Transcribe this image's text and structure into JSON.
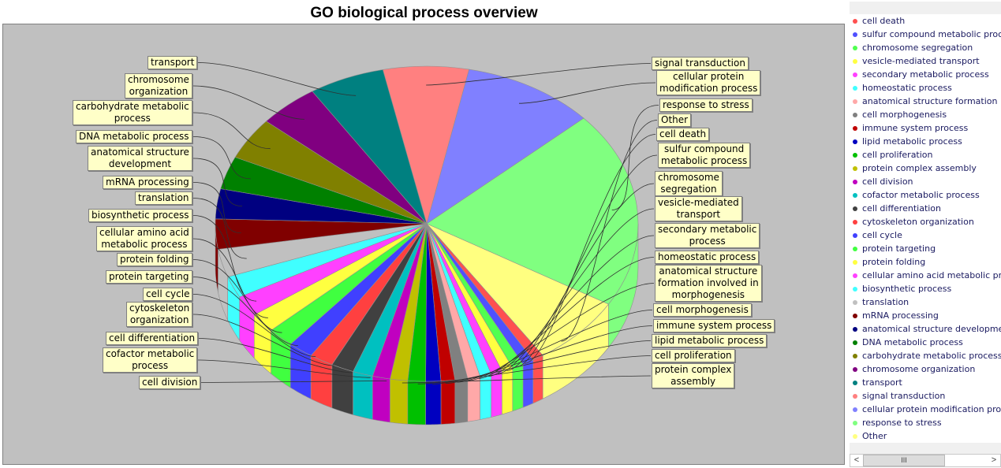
{
  "chart_data": {
    "type": "pie",
    "title": "GO biological process overview",
    "legend_position": "right",
    "slices": [
      {
        "label": "signal transduction",
        "value": 6.8,
        "color": "#ff8080"
      },
      {
        "label": "cellular protein modification process",
        "value": 10.5,
        "color": "#8080ff"
      },
      {
        "label": "response to stress",
        "value": 21.0,
        "color": "#80ff80"
      },
      {
        "label": "Other",
        "value": 7.5,
        "color": "#ffff80"
      },
      {
        "label": "cell death",
        "value": 0.9,
        "color": "#ff5050"
      },
      {
        "label": "sulfur compound metabolic process",
        "value": 0.9,
        "color": "#5050ff"
      },
      {
        "label": "chromosome segregation",
        "value": 0.9,
        "color": "#50ff50"
      },
      {
        "label": "vesicle-mediated transport",
        "value": 0.9,
        "color": "#ffff40"
      },
      {
        "label": "secondary metabolic process",
        "value": 0.9,
        "color": "#ff40ff"
      },
      {
        "label": "homeostatic process",
        "value": 0.9,
        "color": "#40ffff"
      },
      {
        "label": "anatomical structure formation involved in morphogenesis",
        "value": 1.0,
        "color": "#ffa8a8"
      },
      {
        "label": "cell morphogenesis",
        "value": 1.0,
        "color": "#808080"
      },
      {
        "label": "immune system process",
        "value": 1.1,
        "color": "#c00000"
      },
      {
        "label": "lipid metabolic process",
        "value": 1.2,
        "color": "#0000c0"
      },
      {
        "label": "cell proliferation",
        "value": 1.4,
        "color": "#00c000"
      },
      {
        "label": "protein complex assembly",
        "value": 1.4,
        "color": "#c0c000"
      },
      {
        "label": "cell division",
        "value": 1.4,
        "color": "#c000c0"
      },
      {
        "label": "cofactor metabolic process",
        "value": 1.6,
        "color": "#00c0c0"
      },
      {
        "label": "cell differentiation",
        "value": 1.8,
        "color": "#404040"
      },
      {
        "label": "cytoskeleton organization",
        "value": 1.9,
        "color": "#ff4040"
      },
      {
        "label": "cell cycle",
        "value": 2.0,
        "color": "#4040ff"
      },
      {
        "label": "protein targeting",
        "value": 2.1,
        "color": "#40ff40"
      },
      {
        "label": "protein folding",
        "value": 2.1,
        "color": "#ffff40"
      },
      {
        "label": "cellular amino acid metabolic process",
        "value": 2.2,
        "color": "#ff40ff"
      },
      {
        "label": "biosynthetic process",
        "value": 2.3,
        "color": "#40ffff"
      },
      {
        "label": "translation",
        "value": 3.0,
        "color": "#c0c0c0"
      },
      {
        "label": "mRNA processing",
        "value": 3.2,
        "color": "#800000"
      },
      {
        "label": "anatomical structure development",
        "value": 3.2,
        "color": "#000080"
      },
      {
        "label": "DNA metabolic process",
        "value": 3.5,
        "color": "#008000"
      },
      {
        "label": "carbohydrate metabolic process",
        "value": 4.5,
        "color": "#808000"
      },
      {
        "label": "chromosome organization",
        "value": 4.8,
        "color": "#800080"
      },
      {
        "label": "transport",
        "value": 6.0,
        "color": "#008080"
      }
    ],
    "callout_labels_left": [
      "transport",
      "chromosome\norganization",
      "carbohydrate metabolic\nprocess",
      "DNA metabolic process",
      "anatomical structure\ndevelopment",
      "mRNA processing",
      "translation",
      "biosynthetic process",
      "cellular amino acid\nmetabolic process",
      "protein folding",
      "protein targeting",
      "cell cycle",
      "cytoskeleton\norganization",
      "cell differentiation",
      "cofactor metabolic\nprocess",
      "cell division"
    ],
    "callout_labels_right": [
      "signal transduction",
      "cellular protein\nmodification process",
      "response to stress",
      "Other",
      "cell death",
      "sulfur compound\nmetabolic process",
      "chromosome\nsegregation",
      "vesicle-mediated\ntransport",
      "secondary metabolic\nprocess",
      "homeostatic process",
      "anatomical structure\nformation involved in\nmorphogenesis",
      "cell morphogenesis",
      "immune system process",
      "lipid metabolic process",
      "cell proliferation",
      "protein complex\nassembly"
    ]
  },
  "legend": {
    "items": [
      {
        "label": "cell death",
        "color": "#ff5050"
      },
      {
        "label": "sulfur compound metabolic process",
        "color": "#5050ff"
      },
      {
        "label": "chromosome segregation",
        "color": "#50ff50"
      },
      {
        "label": "vesicle-mediated transport",
        "color": "#ffff40"
      },
      {
        "label": "secondary metabolic process",
        "color": "#ff40ff"
      },
      {
        "label": "homeostatic process",
        "color": "#40ffff"
      },
      {
        "label": "anatomical structure formation involv",
        "color": "#ffa8a8"
      },
      {
        "label": "cell morphogenesis",
        "color": "#808080"
      },
      {
        "label": "immune system process",
        "color": "#c00000"
      },
      {
        "label": "lipid metabolic process",
        "color": "#0000c0"
      },
      {
        "label": "cell proliferation",
        "color": "#00c000"
      },
      {
        "label": "protein complex assembly",
        "color": "#c0c000"
      },
      {
        "label": "cell division",
        "color": "#c000c0"
      },
      {
        "label": "cofactor metabolic process",
        "color": "#00c0c0"
      },
      {
        "label": "cell differentiation",
        "color": "#404040"
      },
      {
        "label": "cytoskeleton organization",
        "color": "#ff4040"
      },
      {
        "label": "cell cycle",
        "color": "#4040ff"
      },
      {
        "label": "protein targeting",
        "color": "#40ff40"
      },
      {
        "label": "protein folding",
        "color": "#ffff40"
      },
      {
        "label": "cellular amino acid metabolic process",
        "color": "#ff40ff"
      },
      {
        "label": "biosynthetic process",
        "color": "#40ffff"
      },
      {
        "label": "translation",
        "color": "#c0c0c0"
      },
      {
        "label": "mRNA processing",
        "color": "#800000"
      },
      {
        "label": "anatomical structure development",
        "color": "#000080"
      },
      {
        "label": "DNA metabolic process",
        "color": "#008000"
      },
      {
        "label": "carbohydrate metabolic process",
        "color": "#808000"
      },
      {
        "label": "chromosome organization",
        "color": "#800080"
      },
      {
        "label": "transport",
        "color": "#008080"
      },
      {
        "label": "signal transduction",
        "color": "#ff8080"
      },
      {
        "label": "cellular protein modification process",
        "color": "#8080ff"
      },
      {
        "label": "response to stress",
        "color": "#80ff80"
      },
      {
        "label": "Other",
        "color": "#ffff80"
      }
    ],
    "scrollbar": {
      "left_arrow": "<",
      "right_arrow": ">",
      "thumb_grip": "III"
    }
  }
}
